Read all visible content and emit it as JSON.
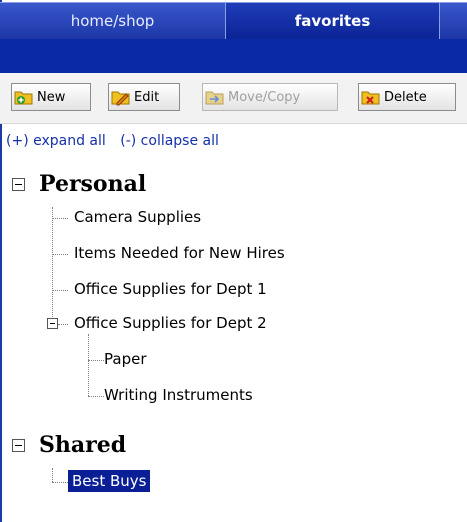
{
  "tabs": {
    "home_label": "home/shop",
    "favorites_label": "favorites"
  },
  "toolbar": {
    "new_label": "New",
    "edit_label": "Edit",
    "move_copy_label": "Move/Copy",
    "delete_label": "Delete"
  },
  "links": {
    "expand_all": "(+) expand all",
    "collapse_all": "(-) collapse all"
  },
  "tree": {
    "personal_label": "Personal",
    "personal_items": [
      "Camera Supplies",
      "Items Needed for New Hires",
      "Office Supplies for Dept 1",
      "Office Supplies for Dept 2"
    ],
    "dept2_children": [
      "Paper",
      "Writing Instruments"
    ],
    "shared_label": "Shared",
    "shared_items": [
      "Best Buys"
    ]
  },
  "colors": {
    "tab_active": "#0b2496",
    "header_band": "#0a2aa5",
    "link": "#1530a8",
    "selection": "#0a1e96"
  },
  "icons": {
    "new": "folder-add-icon",
    "edit": "folder-edit-icon",
    "move_copy": "folder-move-icon",
    "delete": "folder-delete-icon"
  }
}
